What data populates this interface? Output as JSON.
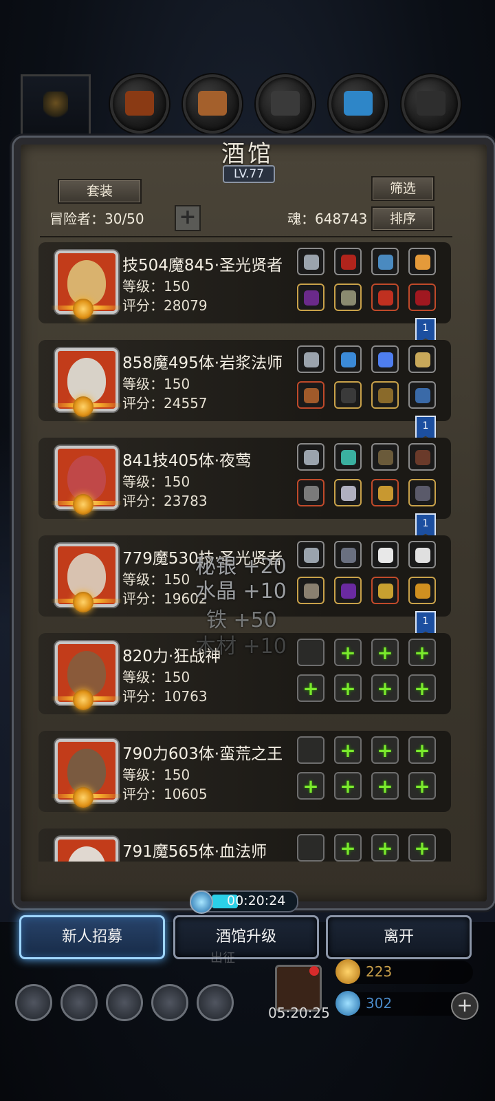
{
  "panel": {
    "title": "酒馆",
    "level": "LV.77",
    "set_button": "套装",
    "filter_button": "筛选",
    "sort_button": "排序",
    "roster_label": "冒险者：30/50",
    "soul_label": "魂：648743"
  },
  "heroes": [
    {
      "name": "技504魔845·圣光贤者",
      "level": "等级：150",
      "score": "评分：28079",
      "badge": "1"
    },
    {
      "name": "858魔495体·岩浆法师",
      "level": "等级：150",
      "score": "评分：24557",
      "badge": "1"
    },
    {
      "name": "841技405体·夜莺",
      "level": "等级：150",
      "score": "评分：23783",
      "badge": "1"
    },
    {
      "name": "779魔530技·圣光贤者",
      "level": "等级：150",
      "score": "评分：19602",
      "badge": "1"
    },
    {
      "name": "820力·狂战神",
      "level": "等级：150",
      "score": "评分：10763"
    },
    {
      "name": "790力603体·蛮荒之王",
      "level": "等级：150",
      "score": "评分：10605"
    },
    {
      "name": "791魔565体·血法师"
    }
  ],
  "floating_rewards": [
    "秘银 +20",
    "水晶 +10",
    "铁 +50",
    "木材 +10"
  ],
  "timer": "00:20:24",
  "buttons": {
    "recruit": "新人招募",
    "upgrade": "酒馆升级",
    "leave": "离开"
  },
  "gift_timer": "05:20:25",
  "resources": {
    "gold": "223",
    "gem": "302"
  },
  "faded_label": "出征",
  "colors": {
    "accent_blue": "#5fb4ff",
    "plus_green": "#7bea2d",
    "portrait_red": "#c23c1a",
    "gold": "#f2a629"
  }
}
